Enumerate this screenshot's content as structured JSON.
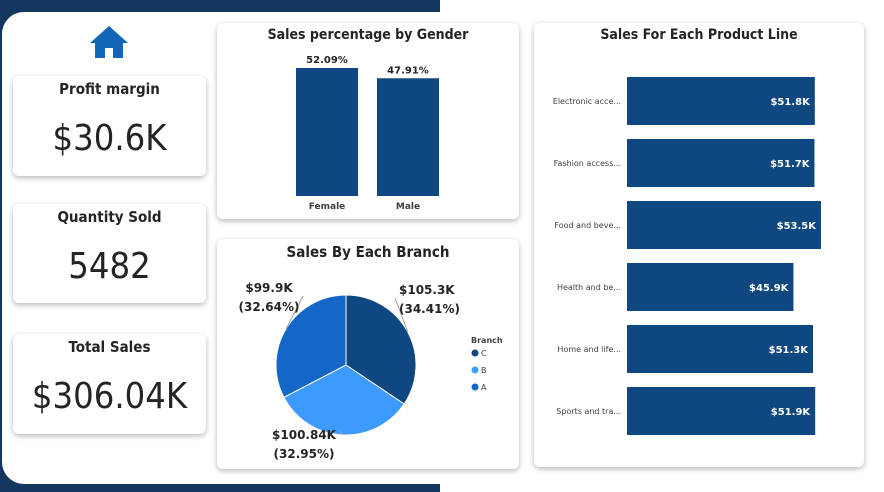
{
  "colors": {
    "navy": "#14375f",
    "bar": "#0f4780",
    "pieC": "#0f4780",
    "pieB": "#3d9bff",
    "pieA": "#1467c6"
  },
  "home_icon": "home-icon",
  "kpis": [
    {
      "title": "Profit margin",
      "value": "$30.6K"
    },
    {
      "title": "Quantity Sold",
      "value": "5482"
    },
    {
      "title": "Total Sales",
      "value": "$306.04K"
    }
  ],
  "charts": {
    "gender_title": "Sales percentage by Gender",
    "branch_title": "Sales By Each Branch",
    "product_title": "Sales For Each Product Line",
    "branch_legend_title": "Branch"
  },
  "chart_data": [
    {
      "type": "bar",
      "title": "Sales percentage by Gender",
      "categories": [
        "Female",
        "Male"
      ],
      "values": [
        52.09,
        47.91
      ],
      "data_labels": [
        "52.09%",
        "47.91%"
      ],
      "ylim": [
        0,
        55
      ]
    },
    {
      "type": "pie",
      "title": "Sales By Each Branch",
      "legend_title": "Branch",
      "categories": [
        "C",
        "B",
        "A"
      ],
      "values": [
        105.3,
        100.84,
        99.9
      ],
      "data_labels": [
        [
          "$105.3K",
          "(34.41%)"
        ],
        [
          "$100.84K",
          "(32.95%)"
        ],
        [
          "$99.9K",
          "(32.64%)"
        ]
      ],
      "legend_position": "right"
    },
    {
      "type": "bar",
      "orientation": "horizontal",
      "title": "Sales For Each Product Line",
      "categories": [
        "Electronic acce...",
        "Fashion access...",
        "Food and beve...",
        "Health and be...",
        "Home and life...",
        "Sports and tra..."
      ],
      "values": [
        51.8,
        51.7,
        53.5,
        45.9,
        51.3,
        51.9
      ],
      "data_labels": [
        "$51.8K",
        "$51.7K",
        "$53.5K",
        "$45.9K",
        "$51.3K",
        "$51.9K"
      ],
      "xlim": [
        0,
        53.5
      ]
    }
  ]
}
